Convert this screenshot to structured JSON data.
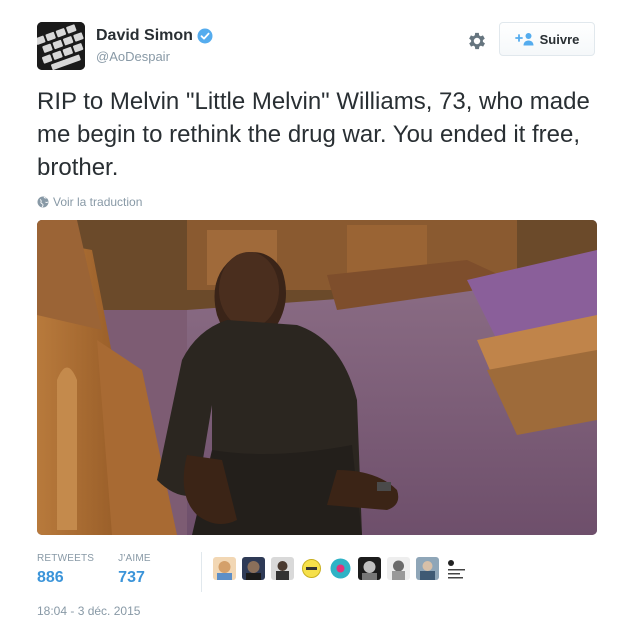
{
  "author": {
    "name": "David Simon",
    "handle": "@AoDespair",
    "verified": true
  },
  "actions": {
    "follow_label": "Suivre"
  },
  "tweet": {
    "text": "RIP to Melvin \"Little Melvin\" Williams, 73, who made me begin to rethink the drug war.  You ended it free, brother.",
    "translate_label": "Voir la traduction"
  },
  "stats": {
    "retweets_label": "RETWEETS",
    "retweets_value": "886",
    "likes_label": "J'AIME",
    "likes_value": "737"
  },
  "likers": [
    {
      "icon": "liker-avatar"
    },
    {
      "icon": "liker-avatar"
    },
    {
      "icon": "liker-avatar"
    },
    {
      "icon": "liker-avatar"
    },
    {
      "icon": "liker-avatar"
    },
    {
      "icon": "liker-avatar"
    },
    {
      "icon": "liker-avatar"
    },
    {
      "icon": "liker-avatar"
    },
    {
      "icon": "liker-avatar"
    }
  ],
  "timestamp": "18:04 - 3 déc. 2015",
  "colors": {
    "link": "#3b94d9",
    "muted": "#8899a6",
    "verified": "#55acee"
  }
}
